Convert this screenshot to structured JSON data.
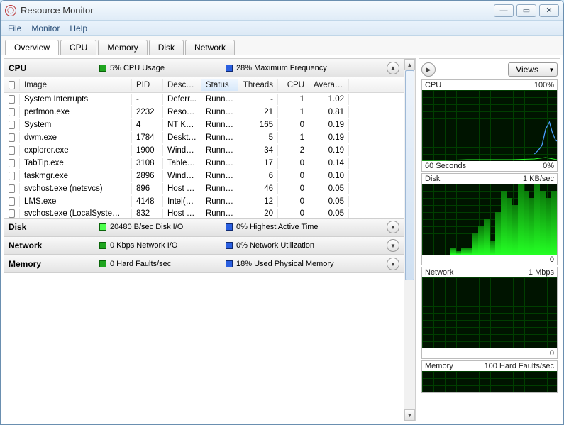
{
  "window": {
    "title": "Resource Monitor",
    "buttons": {
      "min": "—",
      "max": "▭",
      "close": "✕"
    }
  },
  "menubar": [
    "File",
    "Monitor",
    "Help"
  ],
  "tabs": [
    "Overview",
    "CPU",
    "Memory",
    "Disk",
    "Network"
  ],
  "active_tab": 0,
  "panels": {
    "cpu": {
      "title": "CPU",
      "stat1": "5% CPU Usage",
      "stat2": "28% Maximum Frequency"
    },
    "disk": {
      "title": "Disk",
      "stat1": "20480 B/sec Disk I/O",
      "stat2": "0% Highest Active Time"
    },
    "network": {
      "title": "Network",
      "stat1": "0 Kbps Network I/O",
      "stat2": "0% Network Utilization"
    },
    "memory": {
      "title": "Memory",
      "stat1": "0 Hard Faults/sec",
      "stat2": "18% Used Physical Memory"
    }
  },
  "columns": {
    "image": "Image",
    "pid": "PID",
    "desc": "Descrip...",
    "status": "Status",
    "threads": "Threads",
    "cpu": "CPU",
    "avg": "Averag..."
  },
  "processes": [
    {
      "image": "System Interrupts",
      "pid": "-",
      "desc": "Deferr...",
      "status": "Runni...",
      "threads": "-",
      "cpu": "1",
      "avg": "1.02"
    },
    {
      "image": "perfmon.exe",
      "pid": "2232",
      "desc": "Resour...",
      "status": "Runni...",
      "threads": "21",
      "cpu": "1",
      "avg": "0.81"
    },
    {
      "image": "System",
      "pid": "4",
      "desc": "NT Ker...",
      "status": "Runni...",
      "threads": "165",
      "cpu": "0",
      "avg": "0.19"
    },
    {
      "image": "dwm.exe",
      "pid": "1784",
      "desc": "Deskto...",
      "status": "Runni...",
      "threads": "5",
      "cpu": "1",
      "avg": "0.19"
    },
    {
      "image": "explorer.exe",
      "pid": "1900",
      "desc": "Windo...",
      "status": "Runni...",
      "threads": "34",
      "cpu": "2",
      "avg": "0.19"
    },
    {
      "image": "TabTip.exe",
      "pid": "3108",
      "desc": "Tablet ...",
      "status": "Runni...",
      "threads": "17",
      "cpu": "0",
      "avg": "0.14"
    },
    {
      "image": "taskmgr.exe",
      "pid": "2896",
      "desc": "Windo...",
      "status": "Runni...",
      "threads": "6",
      "cpu": "0",
      "avg": "0.10"
    },
    {
      "image": "svchost.exe (netsvcs)",
      "pid": "896",
      "desc": "Host Pr...",
      "status": "Runni...",
      "threads": "46",
      "cpu": "0",
      "avg": "0.05"
    },
    {
      "image": "LMS.exe",
      "pid": "4148",
      "desc": "Intel(R)...",
      "status": "Runni...",
      "threads": "12",
      "cpu": "0",
      "avg": "0.05"
    }
  ],
  "cut_process": {
    "image": "svchost.exe (LocalSystemNet...",
    "pid": "832",
    "desc": "Host Pr...",
    "status": "Runni...",
    "threads": "20",
    "cpu": "0",
    "avg": "0.05"
  },
  "right": {
    "views": "Views",
    "charts": {
      "cpu": {
        "title": "CPU",
        "right": "100%",
        "foot_left": "60 Seconds",
        "foot_right": "0%"
      },
      "disk": {
        "title": "Disk",
        "right": "1 KB/sec",
        "foot_right": "0"
      },
      "network": {
        "title": "Network",
        "right": "1 Mbps",
        "foot_right": "0"
      },
      "memory": {
        "title": "Memory",
        "right": "100 Hard Faults/sec"
      }
    }
  },
  "chart_data": [
    {
      "type": "line",
      "title": "CPU",
      "ylabel": "%",
      "ylim": [
        0,
        100
      ],
      "x_span_seconds": 60,
      "series": [
        {
          "name": "CPU Usage",
          "color": "#2aff2a",
          "values": [
            1,
            1,
            2,
            1,
            2,
            2,
            2,
            2,
            3,
            5,
            3,
            2
          ]
        },
        {
          "name": "Maximum Frequency",
          "color": "#4aa0ff",
          "values": [
            10,
            12,
            10,
            15,
            10,
            12,
            18,
            25,
            40,
            55,
            35,
            28
          ]
        }
      ]
    },
    {
      "type": "bar",
      "title": "Disk",
      "ylabel": "KB/sec",
      "ylim": [
        0,
        1
      ],
      "x_span_seconds": 60,
      "values": [
        0,
        0,
        0,
        0,
        0,
        0.1,
        0.05,
        0.1,
        0.1,
        0.3,
        0.4,
        0.5,
        0.2,
        0.6,
        0.9,
        0.8,
        0.7,
        1.0,
        0.9,
        0.8,
        1.0,
        0.9,
        0.8,
        0.9
      ]
    },
    {
      "type": "line",
      "title": "Network",
      "ylabel": "Mbps",
      "ylim": [
        0,
        1
      ],
      "x_span_seconds": 60,
      "series": [
        {
          "name": "Network",
          "color": "#2aff2a",
          "values": [
            0,
            0,
            0,
            0,
            0,
            0,
            0,
            0,
            0,
            0,
            0,
            0
          ]
        }
      ]
    },
    {
      "type": "line",
      "title": "Memory",
      "ylabel": "Hard Faults/sec",
      "ylim": [
        0,
        100
      ],
      "x_span_seconds": 60,
      "series": [
        {
          "name": "Hard Faults",
          "color": "#2aff2a",
          "values": [
            0,
            0,
            0,
            0,
            0,
            0,
            0,
            0,
            0,
            0,
            0,
            0
          ]
        }
      ]
    }
  ]
}
